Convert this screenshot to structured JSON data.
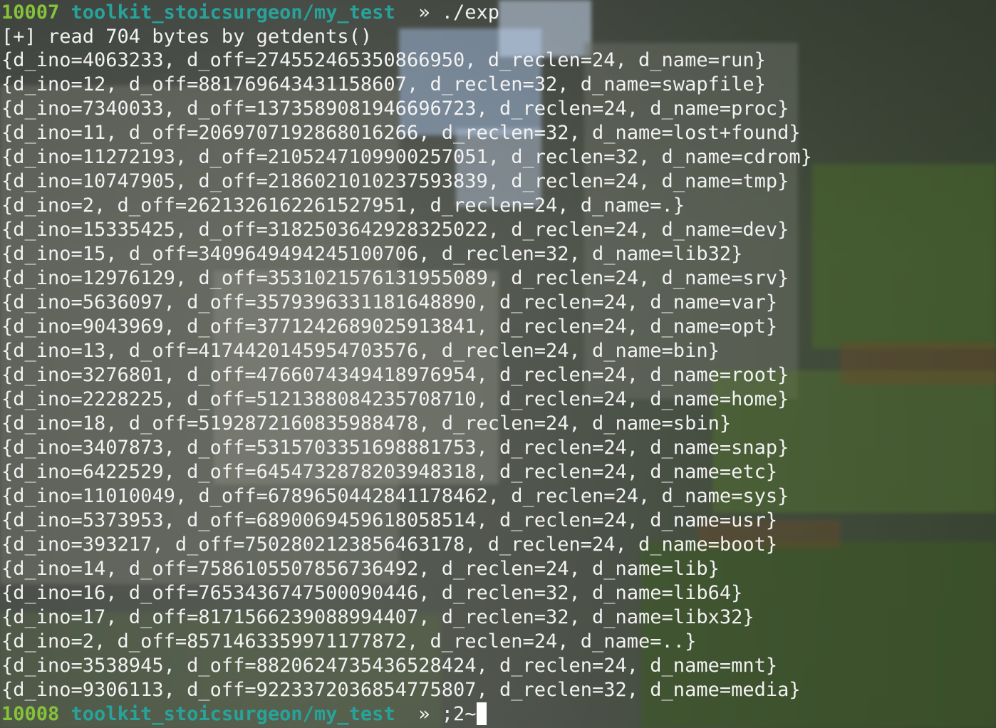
{
  "prompt1": {
    "number": "10007",
    "path": "toolkit_stoicsurgeon/my_test",
    "separator": "  » ",
    "command": "./exp"
  },
  "read_line": "[+] read 704 bytes by getdents()",
  "entries": [
    "{d_ino=4063233, d_off=274552465350866950, d_reclen=24, d_name=run}",
    "{d_ino=12, d_off=881769643431158607, d_reclen=32, d_name=swapfile}",
    "{d_ino=7340033, d_off=1373589081946696723, d_reclen=24, d_name=proc}",
    "{d_ino=11, d_off=2069707192868016266, d_reclen=32, d_name=lost+found}",
    "{d_ino=11272193, d_off=2105247109900257051, d_reclen=32, d_name=cdrom}",
    "{d_ino=10747905, d_off=2186021010237593839, d_reclen=24, d_name=tmp}",
    "{d_ino=2, d_off=2621326162261527951, d_reclen=24, d_name=.}",
    "{d_ino=15335425, d_off=3182503642928325022, d_reclen=24, d_name=dev}",
    "{d_ino=15, d_off=3409649494245100706, d_reclen=32, d_name=lib32}",
    "{d_ino=12976129, d_off=3531021576131955089, d_reclen=24, d_name=srv}",
    "{d_ino=5636097, d_off=3579396331181648890, d_reclen=24, d_name=var}",
    "{d_ino=9043969, d_off=3771242689025913841, d_reclen=24, d_name=opt}",
    "{d_ino=13, d_off=4174420145954703576, d_reclen=24, d_name=bin}",
    "{d_ino=3276801, d_off=4766074349418976954, d_reclen=24, d_name=root}",
    "{d_ino=2228225, d_off=5121388084235708710, d_reclen=24, d_name=home}",
    "{d_ino=18, d_off=5192872160835988478, d_reclen=24, d_name=sbin}",
    "{d_ino=3407873, d_off=5315703351698881753, d_reclen=24, d_name=snap}",
    "{d_ino=6422529, d_off=6454732878203948318, d_reclen=24, d_name=etc}",
    "{d_ino=11010049, d_off=6789650442841178462, d_reclen=24, d_name=sys}",
    "{d_ino=5373953, d_off=6890069459618058514, d_reclen=24, d_name=usr}",
    "{d_ino=393217, d_off=7502802123856463178, d_reclen=24, d_name=boot}",
    "{d_ino=14, d_off=7586105507856736492, d_reclen=24, d_name=lib}",
    "{d_ino=16, d_off=7653436747500090446, d_reclen=32, d_name=lib64}",
    "{d_ino=17, d_off=8171566239088994407, d_reclen=32, d_name=libx32}",
    "{d_ino=2, d_off=8571463359971177872, d_reclen=24, d_name=..}",
    "{d_ino=3538945, d_off=8820624735436528424, d_reclen=24, d_name=mnt}",
    "{d_ino=9306113, d_off=9223372036854775807, d_reclen=32, d_name=media}"
  ],
  "prompt2": {
    "number": "10008",
    "path": "toolkit_stoicsurgeon/my_test",
    "separator": "  » ",
    "input": ";2~"
  },
  "colors": {
    "prompt_number": "#86c23a",
    "prompt_path": "#27a39b",
    "text": "#f2f2f2"
  }
}
